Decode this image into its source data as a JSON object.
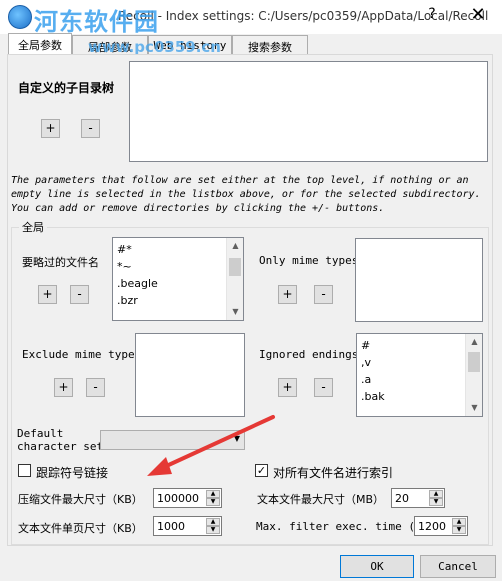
{
  "window": {
    "title": "Recoll - Index settings: C:/Users/pc0359/AppData/Local/Recoll",
    "watermark_logo": "河东软件园",
    "watermark_url": "www.pc0359.cn",
    "help_label": "?",
    "close_label": "✕"
  },
  "tabs": [
    {
      "label": "全局参数"
    },
    {
      "label": "局部参数"
    },
    {
      "label": "Web history"
    },
    {
      "label": "搜索参数"
    }
  ],
  "subdirs": {
    "label": "自定义的子目录树",
    "add": "+",
    "remove": "-"
  },
  "note": {
    "line1": "The parameters that follow are set either at the top level, if nothing or an",
    "line2": "empty line is selected in the listbox above, or for the selected subdirectory.",
    "line3": "You can add or remove directories by clicking the +/- buttons."
  },
  "global_group": {
    "title": "全局",
    "skipped_names": {
      "label": "要略过的文件名",
      "items": [
        "#*",
        "*~",
        ".beagle",
        ".bzr"
      ],
      "add": "+",
      "remove": "-"
    },
    "only_mime": {
      "label": "Only mime types",
      "add": "+",
      "remove": "-"
    },
    "exclude_mime": {
      "label": "Exclude mime types",
      "add": "+",
      "remove": "-"
    },
    "ignored_endings": {
      "label": "Ignored endings",
      "items": [
        "#",
        ",v",
        ".a",
        ".bak"
      ],
      "add": "+",
      "remove": "-"
    },
    "charset": {
      "label_line1": "Default",
      "label_line2": "character set",
      "value": ""
    },
    "follow_symlinks": {
      "label": "跟踪符号链接",
      "checked": false,
      "check_glyph": ""
    },
    "index_all_names": {
      "label": "对所有文件名进行索引",
      "checked": true,
      "check_glyph": "✓"
    },
    "compressed_max": {
      "label": "压缩文件最大尺寸（KB）",
      "value": "100000"
    },
    "text_max": {
      "label": "文本文件最大尺寸（MB）",
      "value": "20"
    },
    "text_page": {
      "label": "文本文件单页尺寸（KB）",
      "value": "1000"
    },
    "filter_time": {
      "label": "Max. filter exec. time (s)",
      "value": "1200"
    }
  },
  "buttons": {
    "ok": "OK",
    "cancel": "Cancel"
  },
  "icons": {
    "app": "recoll-app-icon",
    "scroll_up": "▲",
    "scroll_down": "▼",
    "combo_dropdown": "▼",
    "spin_up": "▲",
    "spin_down": "▼"
  },
  "colors": {
    "annotation_arrow": "#e53935",
    "accent": "#0078d7"
  }
}
